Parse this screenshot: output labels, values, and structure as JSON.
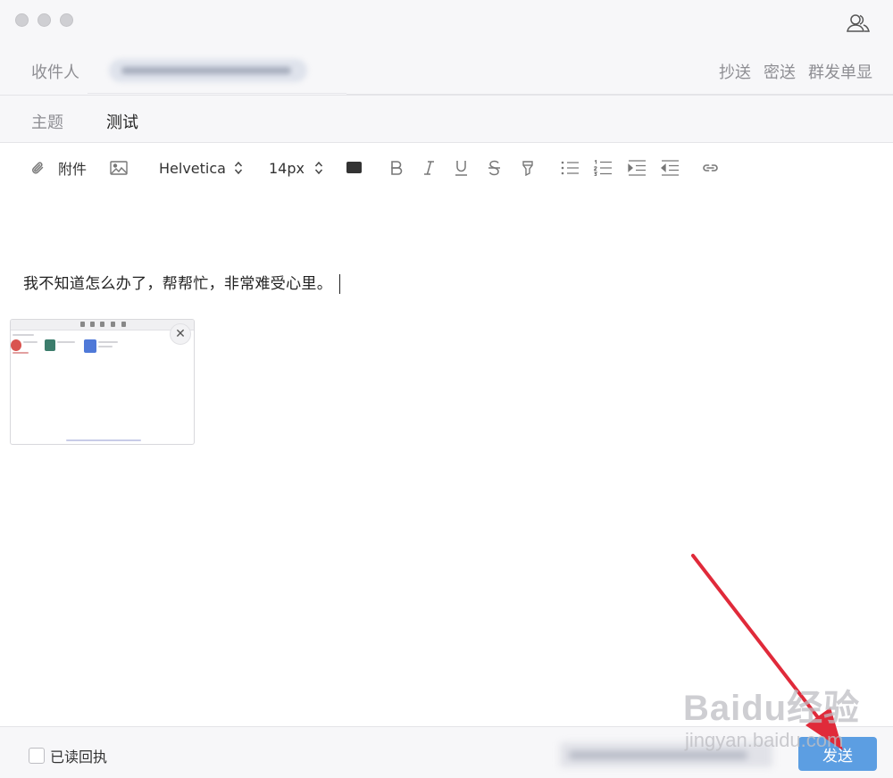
{
  "header": {
    "recipient_label": "收件人",
    "subject_label": "主题",
    "subject_value": "测试",
    "actions": {
      "cc": "抄送",
      "bcc": "密送",
      "mass_single": "群发单显"
    }
  },
  "toolbar": {
    "attach_label": "附件",
    "font_family": "Helvetica",
    "font_size": "14px"
  },
  "editor": {
    "body_text": "我不知道怎么办了，帮帮忙，非常难受心里。"
  },
  "footer": {
    "read_receipt_label": "已读回执",
    "send_label": "发送"
  },
  "watermark": {
    "logo_text": "Baidu经验",
    "url": "jingyan.baidu.com"
  },
  "colors": {
    "accent": "#5c9ee2",
    "annotation_arrow": "#e02a3a"
  },
  "icons": [
    "contacts-icon",
    "paperclip-icon",
    "image-icon",
    "chevron-updown-icon",
    "text-color-icon",
    "bold-icon",
    "italic-icon",
    "underline-icon",
    "strikethrough-icon",
    "highlighter-icon",
    "bullet-list-icon",
    "numbered-list-icon",
    "indent-icon",
    "outdent-icon",
    "link-icon",
    "close-icon"
  ]
}
